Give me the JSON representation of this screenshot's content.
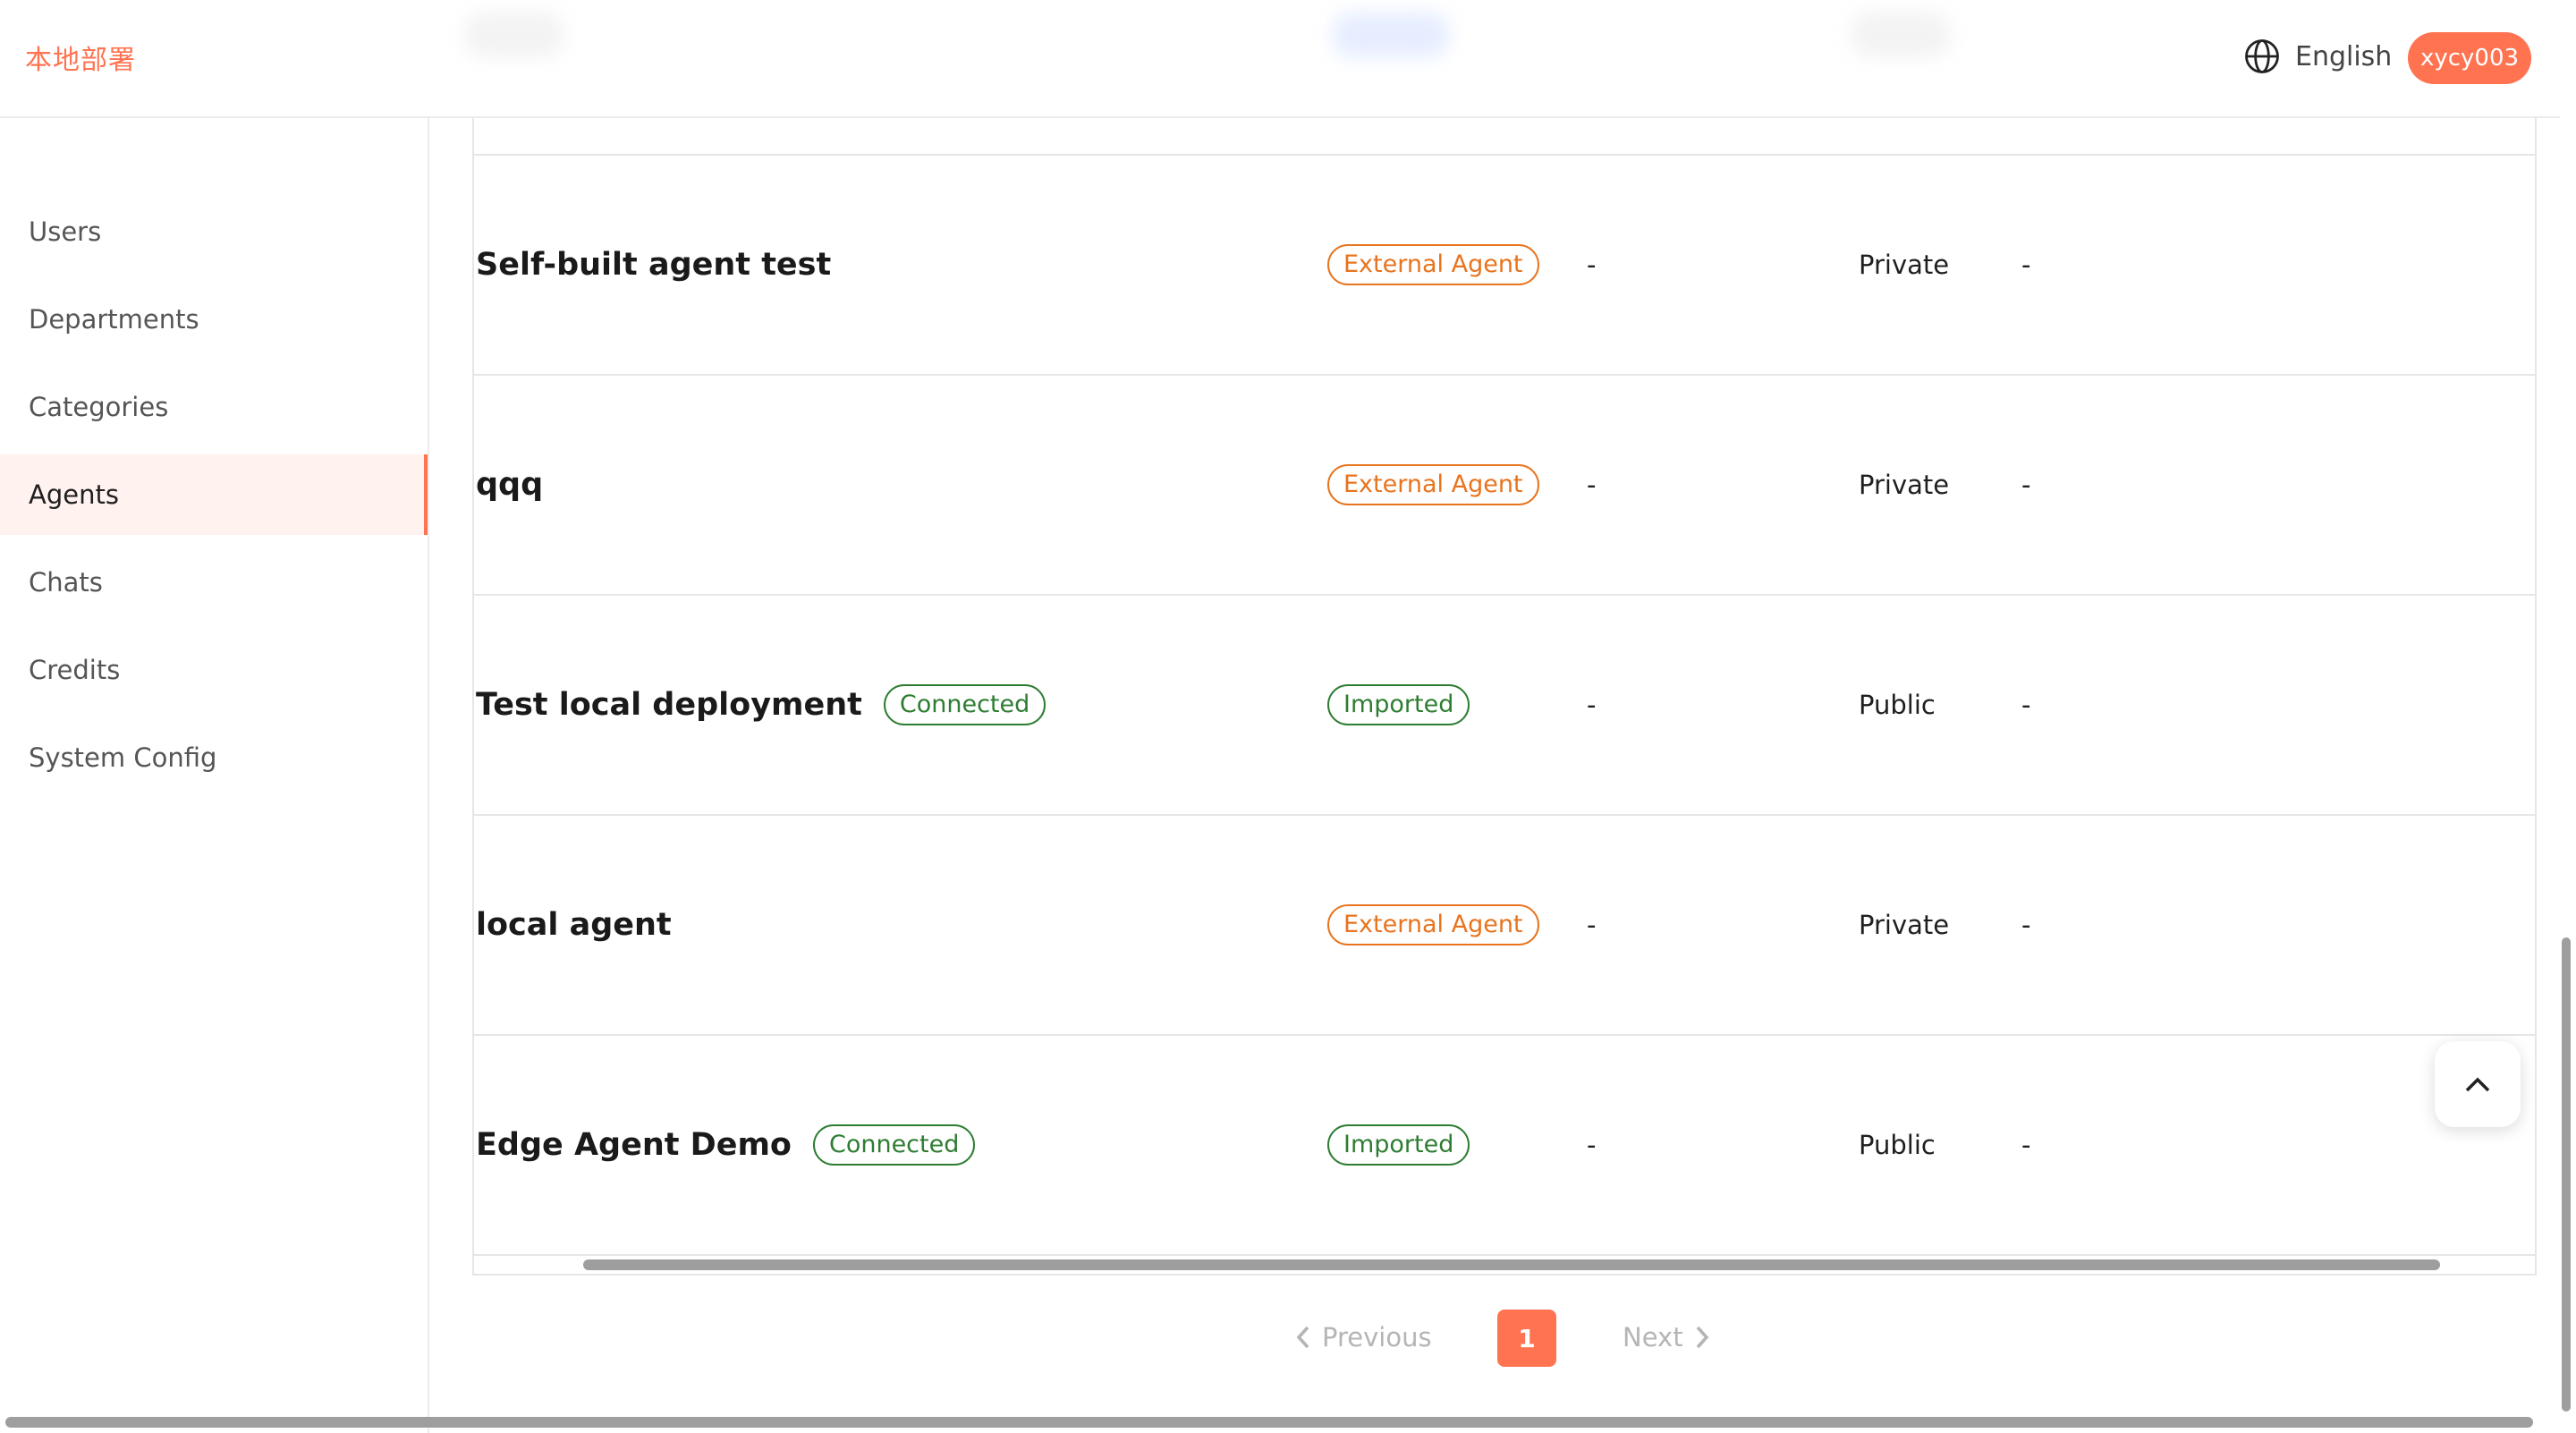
{
  "header": {
    "brand": "本地部署",
    "language": "English",
    "user": "xycy003"
  },
  "sidebar": {
    "items": [
      {
        "label": "Users"
      },
      {
        "label": "Departments"
      },
      {
        "label": "Categories"
      },
      {
        "label": "Agents",
        "active": true
      },
      {
        "label": "Chats"
      },
      {
        "label": "Credits"
      },
      {
        "label": "System Config"
      }
    ]
  },
  "table": {
    "rows": [
      {
        "name": "Self-built agent test",
        "status": "",
        "type": "External Agent",
        "col3": "-",
        "visibility": "Private",
        "col5": "-"
      },
      {
        "name": "qqq",
        "status": "",
        "type": "External Agent",
        "col3": "-",
        "visibility": "Private",
        "col5": "-"
      },
      {
        "name": "Test local deployment",
        "status": "Connected",
        "type": "Imported",
        "col3": "-",
        "visibility": "Public",
        "col5": "-"
      },
      {
        "name": "local agent",
        "status": "",
        "type": "External Agent",
        "col3": "-",
        "visibility": "Private",
        "col5": "-"
      },
      {
        "name": "Edge Agent Demo",
        "status": "Connected",
        "type": "Imported",
        "col3": "-",
        "visibility": "Public",
        "col5": "-"
      }
    ]
  },
  "pagination": {
    "previous": "Previous",
    "current": "1",
    "next": "Next"
  },
  "colors": {
    "accent": "#ff7350",
    "connected": "#2e7d32",
    "external": "#e8741e"
  }
}
